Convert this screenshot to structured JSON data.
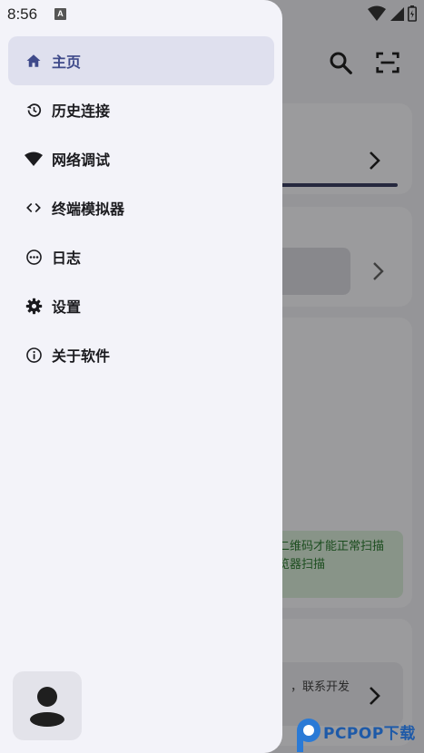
{
  "status_bar": {
    "time": "8:56",
    "notification_icon": "a-letter-icon",
    "icons": [
      "wifi-icon",
      "signal-icon",
      "battery-icon"
    ]
  },
  "drawer": {
    "items": [
      {
        "label": "主页",
        "icon": "home-icon",
        "active": true
      },
      {
        "label": "历史连接",
        "icon": "history-icon",
        "active": false
      },
      {
        "label": "网络调试",
        "icon": "wifi-icon",
        "active": false
      },
      {
        "label": "终端模拟器",
        "icon": "code-icon",
        "active": false
      },
      {
        "label": "日志",
        "icon": "more-horizontal-circle-icon",
        "active": false
      },
      {
        "label": "设置",
        "icon": "gear-icon",
        "active": false
      },
      {
        "label": "关于软件",
        "icon": "info-icon",
        "active": false
      }
    ],
    "avatar_icon": "person-icon"
  },
  "background": {
    "header_icons": [
      "search-icon",
      "scan-icon"
    ],
    "green_notice_line1": "二维码才能正常扫描",
    "green_notice_line2": "览器扫描",
    "contact_text": "，联系开发"
  },
  "watermark": {
    "text": "PCPOP下载"
  },
  "colors": {
    "drawer_bg": "#f3f3f9",
    "active_item_bg": "#dfe0ee",
    "active_item_text": "#3f4a8a",
    "scrim": "rgba(0,0,0,0.38)"
  }
}
